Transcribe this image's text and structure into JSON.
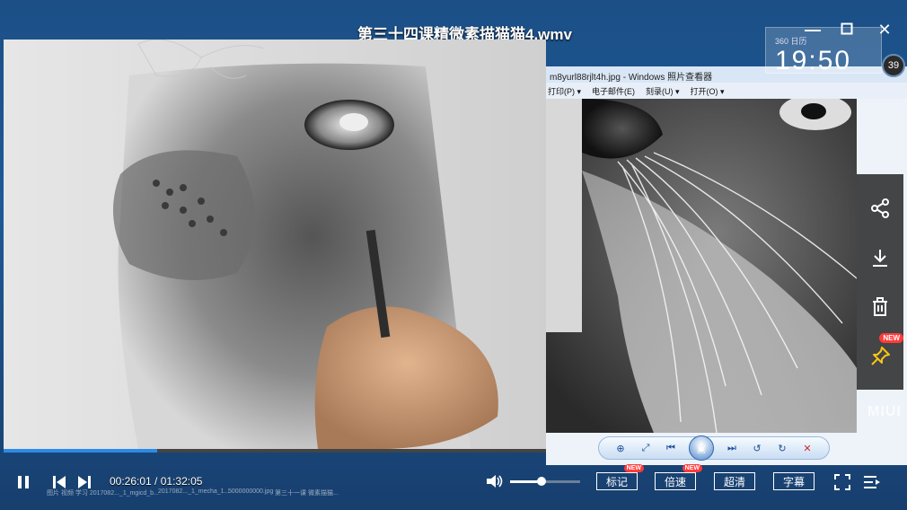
{
  "player": {
    "video_title": "第三十四课精微素描猫猫4.wmv",
    "current_time": "00:26:01",
    "time_separator": " / ",
    "total_time": "01:32:05",
    "progress": 0.2825,
    "volume": 0.45,
    "buttons": {
      "mark_label": "标记",
      "speed_label": "倍速",
      "quality_label": "超清",
      "subtitle_label": "字幕"
    },
    "badges": {
      "new": "NEW"
    },
    "accent_color": "#2b8be6"
  },
  "viewer": {
    "title": "m8yurl88rjlt4h.jpg - Windows 照片查看器",
    "menu": [
      "打印(P) ▾",
      "电子邮件(E)",
      "刻录(U) ▾",
      "打开(O) ▾"
    ],
    "watermark": "MIUI"
  },
  "clock": {
    "small_label": "360 日历",
    "time": "19:50",
    "temperature": "39"
  },
  "side_bar": {
    "icons": [
      "share-icon",
      "download-icon",
      "trash-icon",
      "pin-icon"
    ],
    "new_badge": "NEW"
  },
  "taskbar_files": [
    "图片 视频 学习 2017082..._1_mgicd_b...",
    "2017082..._1_mecha_1...",
    "5000000000.jpg",
    "第三十一课 微素描猫..."
  ]
}
